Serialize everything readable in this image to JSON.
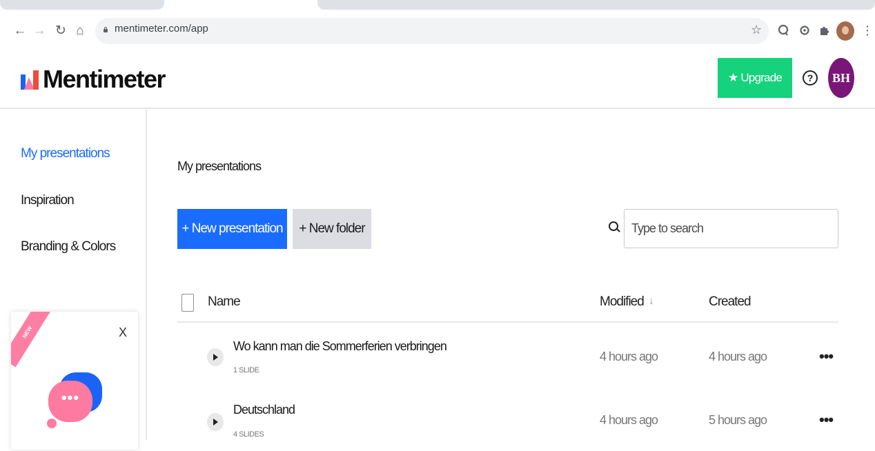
{
  "browser": {
    "url": "mentimeter.com/app",
    "back_icon": "←",
    "forward_icon": "→",
    "reload_icon": "↻",
    "home_icon": "⌂",
    "star_icon": "☆",
    "more_icon": "⋮"
  },
  "app": {
    "brand": "Mentimeter",
    "upgrade_label": "Upgrade",
    "upgrade_icon": "★",
    "help_icon": "?",
    "user_initials": "BH"
  },
  "sidebar": {
    "items": [
      {
        "label": "My presentations",
        "active": true
      },
      {
        "label": "Inspiration",
        "active": false
      },
      {
        "label": "Branding & Colors",
        "active": false
      }
    ],
    "promo": {
      "badge": "NEW",
      "close": "X",
      "bubble_dots": "•••"
    }
  },
  "main": {
    "title": "My presentations",
    "new_presentation": "+ New presentation",
    "new_folder": "+ New folder",
    "search_placeholder": "Type to search",
    "columns": {
      "name": "Name",
      "modified": "Modified",
      "modified_sort_icon": "↓",
      "created": "Created"
    },
    "rows": [
      {
        "title": "Wo kann man die Sommerferien verbringen",
        "slides": "1 SLIDE",
        "modified": "4 hours ago",
        "created": "4 hours ago",
        "menu": "•••"
      },
      {
        "title": "Deutschland",
        "slides": "4 SLIDES",
        "modified": "4 hours ago",
        "created": "5 hours ago",
        "menu": "•••"
      }
    ]
  }
}
